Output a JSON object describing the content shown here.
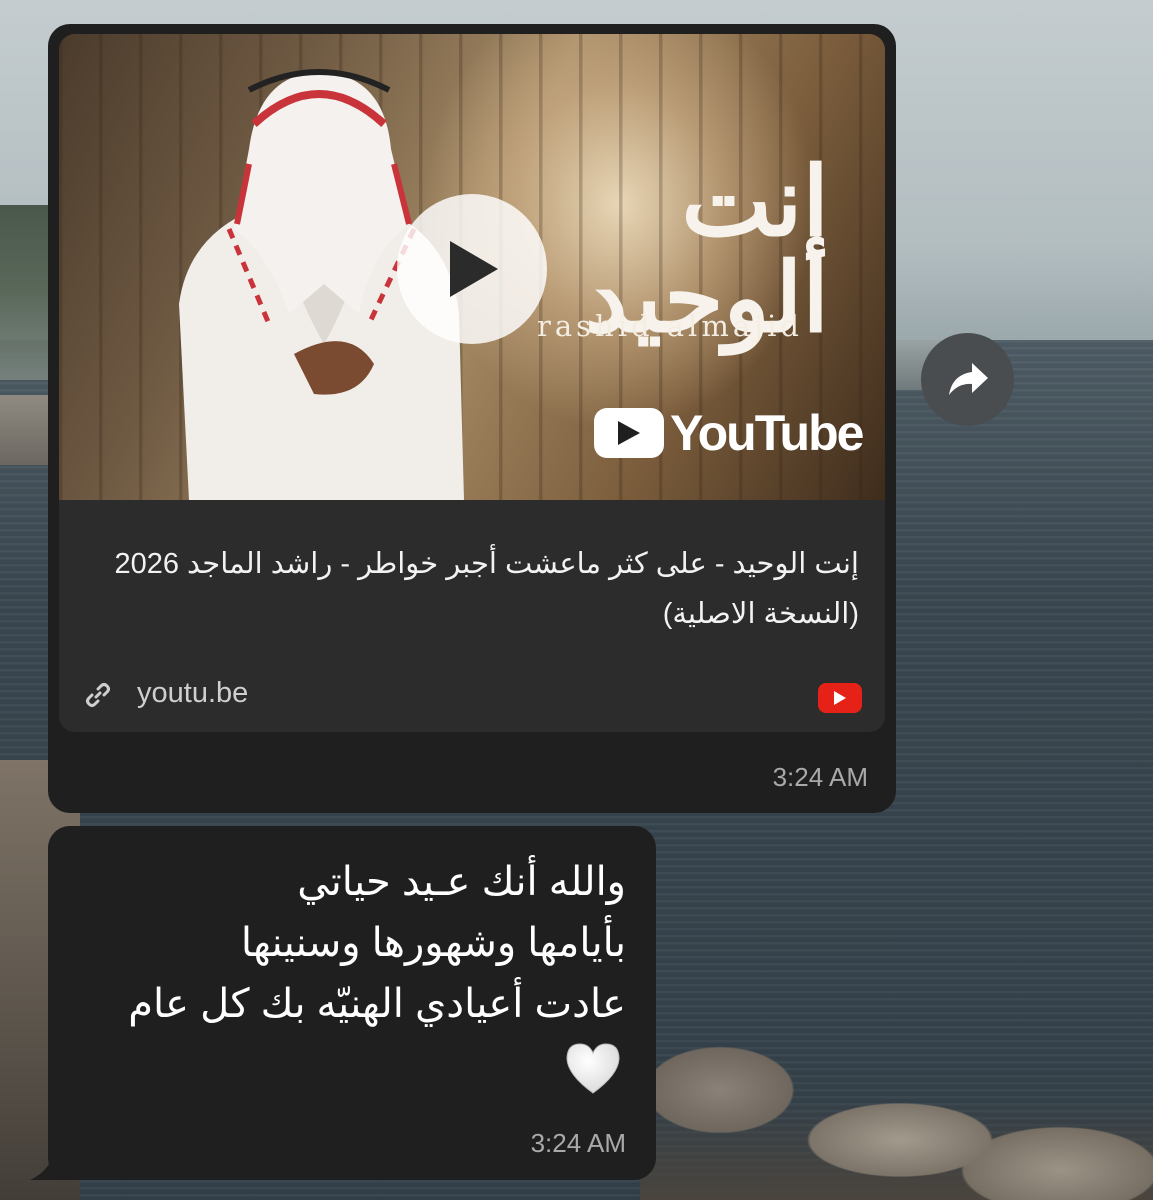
{
  "link_message": {
    "preview": {
      "thumbnail": {
        "calligraphy_title": "إنت الوحيد",
        "artist_latin": "rashid almajid",
        "youtube_wordmark": "YouTube",
        "play_icon": "play-icon"
      },
      "title": "إنت الوحيد - على كثر ماعشت أجبر خواطر - راشد الماجد 2026 (النسخة الاصلية)",
      "domain": "youtu.be",
      "link_icon": "link-icon",
      "source_icon": "youtube-icon"
    },
    "timestamp": "3:24 AM"
  },
  "share_button": {
    "icon": "share-arrow-icon"
  },
  "text_message": {
    "lines": [
      "والله أنك عـيد حياتي",
      "بأيامها وشهورها وسنينها",
      "عادت أعيادي الهنيّه بك كل عام"
    ],
    "emoji": "heart-icon",
    "timestamp": "3:24 AM"
  },
  "colors": {
    "bubble": "#1f1f1f",
    "card": "#2c2c2c",
    "youtube_red": "#e62117",
    "timestamp": "#a9a9a9"
  }
}
